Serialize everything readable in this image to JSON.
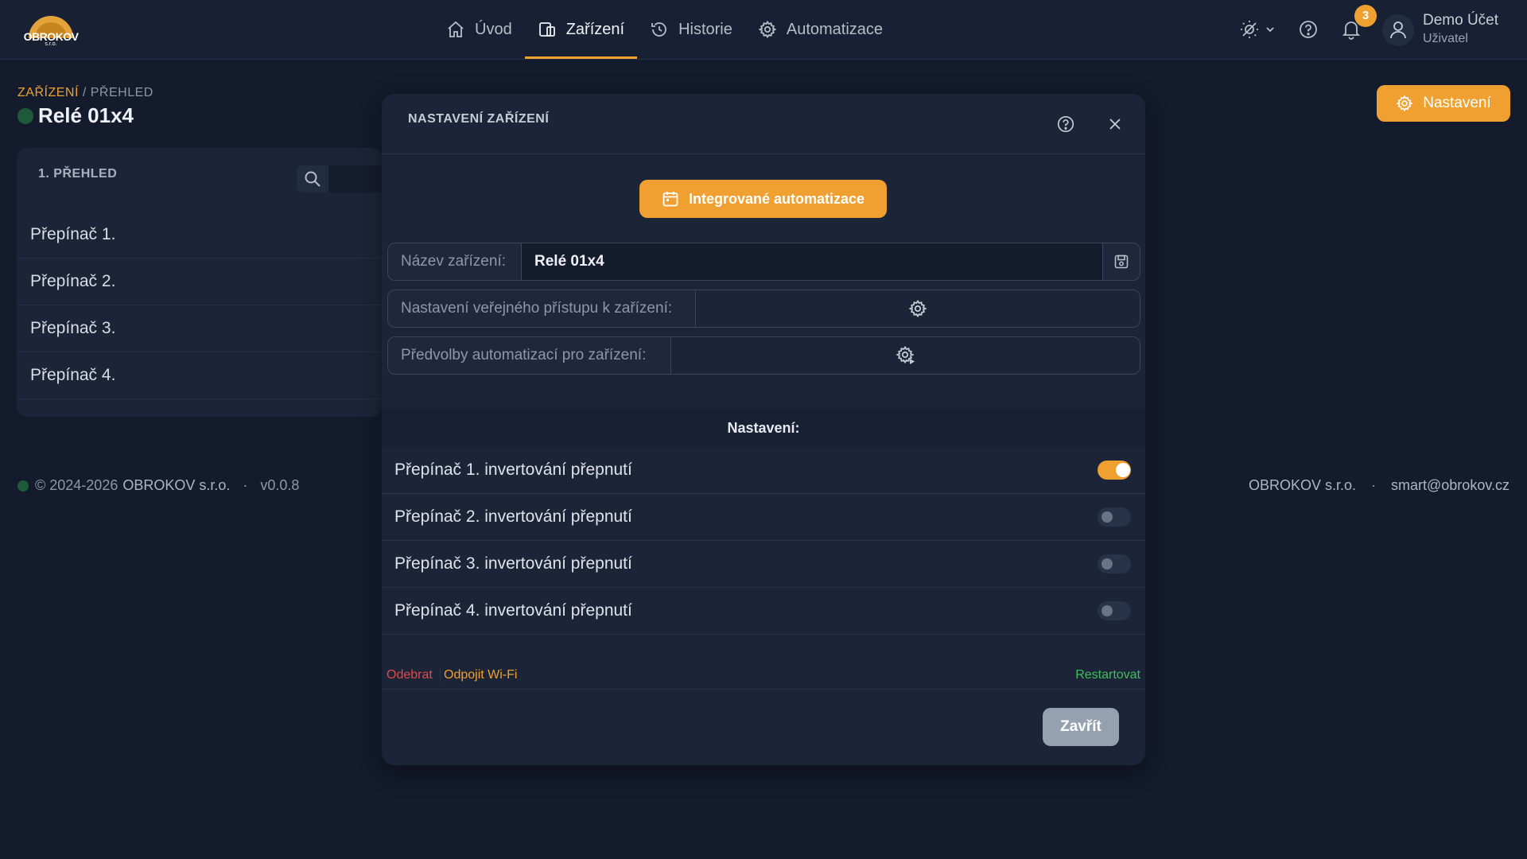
{
  "brand": {
    "logo_text": "OBROKOV",
    "logo_sub": "s.r.o."
  },
  "nav": {
    "items": [
      {
        "label": "Úvod",
        "icon": "home-icon",
        "active": false
      },
      {
        "label": "Zařízení",
        "icon": "devices-icon",
        "active": true
      },
      {
        "label": "Historie",
        "icon": "history-icon",
        "active": false
      },
      {
        "label": "Automatizace",
        "icon": "gear-icon",
        "active": false
      }
    ]
  },
  "topbar": {
    "notification_count": "3",
    "user_name": "Demo Účet",
    "user_role": "Uživatel"
  },
  "page": {
    "breadcrumb_first": "ZAŘÍZENÍ",
    "breadcrumb_sep": " / ",
    "breadcrumb_second": "PŘEHLED",
    "device_title": "Relé 01x4",
    "settings_button": "Nastavení"
  },
  "panel": {
    "title": "1. PŘEHLED",
    "items": [
      "Přepínač 1.",
      "Přepínač 2.",
      "Přepínač 3.",
      "Přepínač 4."
    ]
  },
  "footer": {
    "copyright": "© 2024-2026",
    "company": "OBROKOV s.r.o.",
    "separator": "·",
    "version": "v0.0.8",
    "right_company": "OBROKOV s.r.o.",
    "email": "smart@obrokov.cz"
  },
  "modal": {
    "title": "NASTAVENÍ ZAŘÍZENÍ",
    "integrated_button": "Integrované automatizace",
    "name_label": "Název zařízení:",
    "name_value": "Relé 01x4",
    "public_access_label": "Nastavení veřejného přístupu k zařízení:",
    "presets_label": "Předvolby automatizací pro zařízení:",
    "section_title": "Nastavení:",
    "toggles": [
      {
        "label": "Přepínač 1. invertování přepnutí",
        "on": true
      },
      {
        "label": "Přepínač 2. invertování přepnutí",
        "on": false
      },
      {
        "label": "Přepínač 3. invertování přepnutí",
        "on": false
      },
      {
        "label": "Přepínač 4. invertování přepnutí",
        "on": false
      }
    ],
    "action_remove": "Odebrat",
    "action_wifi": "Odpojit Wi-Fi",
    "action_restart": "Restartovat",
    "close_button": "Zavřít"
  },
  "colors": {
    "accent": "#f0a030",
    "background": "#131b2c",
    "danger": "#e04848",
    "success": "#3fbf5c"
  }
}
